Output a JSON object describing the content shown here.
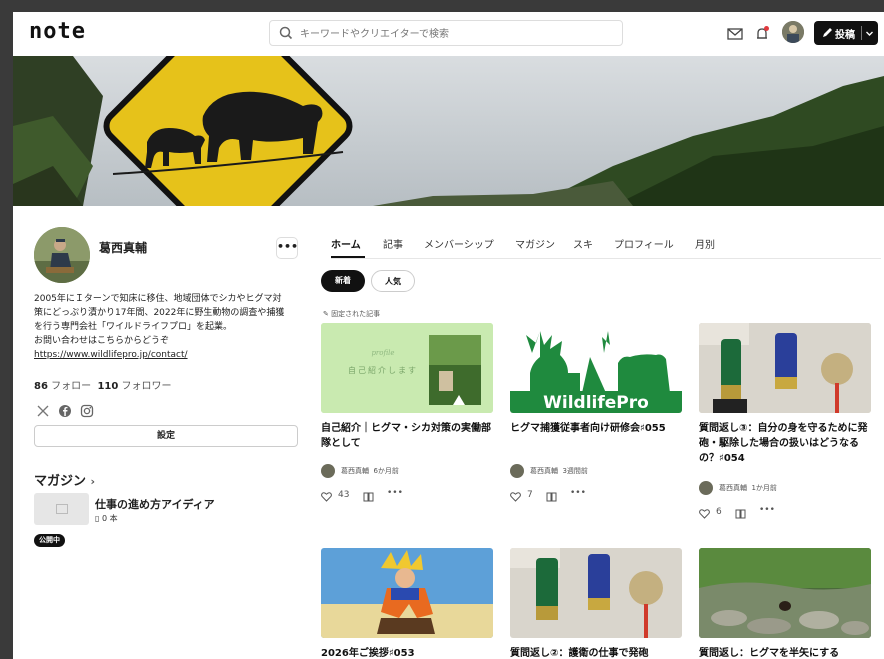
{
  "header": {
    "logo": "note",
    "search_placeholder": "キーワードやクリエイターで検索",
    "post_button": "投稿"
  },
  "profile": {
    "name": "葛西真輔",
    "more": "•••",
    "bio_lines": [
      "2005年にＩターンで知床に移住、地域団体でシカやヒグマ対",
      "策にどっぷり漬かり17年間、2022年に野生動物の調査や捕獲",
      "を行う専門会社「ワイルドライフプロ」を起業。",
      "お問い合わせはこちらからどうぞ"
    ],
    "link": "https://www.wildlifepro.jp/contact/",
    "follow_count": "86",
    "follow_label": "フォロー",
    "follower_count": "110",
    "follower_label": "フォロワー",
    "settings_label": "設定"
  },
  "magazine": {
    "heading": "マガジン",
    "title": "仕事の進め方アイディア",
    "count": "0 本",
    "status": "公開中"
  },
  "tabs": [
    "ホーム",
    "記事",
    "メンバーシップ",
    "マガジン",
    "スキ",
    "プロフィール",
    "月別"
  ],
  "filters": {
    "new": "新着",
    "popular": "人気"
  },
  "pinned_label": "固定された記事",
  "cards": [
    {
      "title": "自己紹介｜ヒグマ・シカ対策の実働部隊として",
      "author": "葛西真輔",
      "time": "6か月前",
      "likes": "43",
      "thumb_script": "profile",
      "thumb_text": "自己紹介します"
    },
    {
      "title": "ヒグマ捕獲従事者向け研修会♯055",
      "author": "葛西真輔",
      "time": "3週間前",
      "likes": "7",
      "thumb_brand": "WildlifePro"
    },
    {
      "title": "質問返し③：自分の身を守るために発砲・駆除した場合の扱いはどうなるの？♯054",
      "author": "葛西真輔",
      "time": "1か月前",
      "likes": "6"
    },
    {
      "title": "2026年ご挨拶♯053"
    },
    {
      "title": "質問返し②：護衛の仕事で発砲"
    },
    {
      "title": "質問返し：ヒグマを半矢にする"
    }
  ],
  "colors": {
    "accent": "#111111",
    "pinned_bg": "#c9eab0",
    "notify_dot": "#e0393e"
  }
}
